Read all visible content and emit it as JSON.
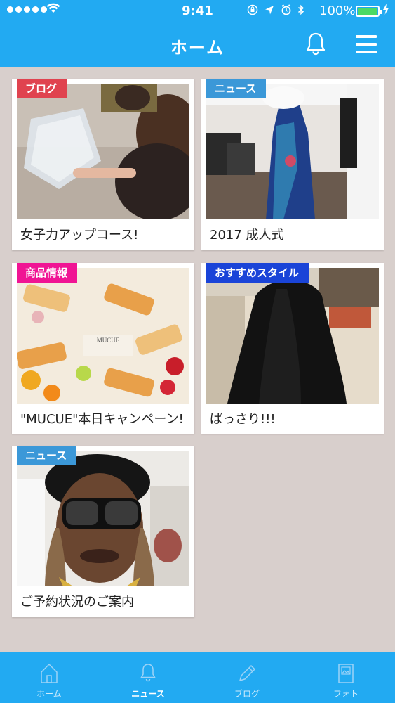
{
  "status_bar": {
    "time": "9:41",
    "battery": "100%",
    "icons": [
      "rotation-lock-icon",
      "location-icon",
      "alarm-icon",
      "bluetooth-icon"
    ]
  },
  "header": {
    "title": "ホーム"
  },
  "colors": {
    "brand": "#22aaf2",
    "tag_blog": "#e0434f",
    "tag_news": "#3b98d8",
    "tag_product": "#f01494",
    "tag_style": "#1a44d8",
    "background": "#d8cfcc"
  },
  "cards": [
    {
      "tag": "ブログ",
      "caption": "女子力アップコース!"
    },
    {
      "tag": "ニュース",
      "caption": "2017 成人式"
    },
    {
      "tag": "商品情報",
      "caption": "\"MUCUE\"本日キャンペーン!",
      "photo_text": "MUCUE"
    },
    {
      "tag": "おすすめスタイル",
      "caption": "ばっさり!!!"
    },
    {
      "tag": "ニュース",
      "caption": "ご予約状況のご案内"
    }
  ],
  "tabbar": {
    "items": [
      {
        "label": "ホーム",
        "icon": "home-icon",
        "active": false
      },
      {
        "label": "ニュース",
        "icon": "bell-icon",
        "active": true
      },
      {
        "label": "ブログ",
        "icon": "pencil-icon",
        "active": false
      },
      {
        "label": "フォト",
        "icon": "photo-icon",
        "active": false
      }
    ]
  }
}
